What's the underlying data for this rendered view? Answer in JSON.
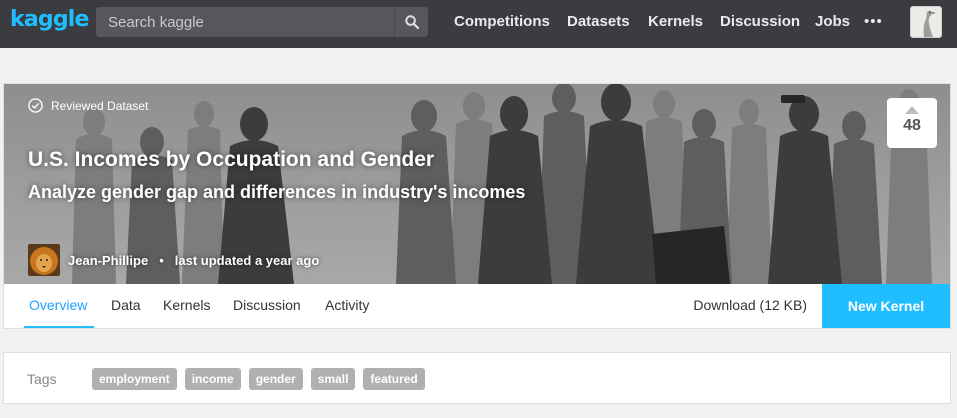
{
  "nav": {
    "logo": "kaggle",
    "search_placeholder": "Search kaggle",
    "items": [
      {
        "label": "Competitions"
      },
      {
        "label": "Datasets"
      },
      {
        "label": "Kernels"
      },
      {
        "label": "Discussion"
      },
      {
        "label": "Jobs"
      }
    ],
    "more": "•••",
    "icons": {
      "search": "search-icon",
      "more": "more-icon",
      "avatar": "user-avatar"
    }
  },
  "dataset": {
    "badge": "Reviewed Dataset",
    "title": "U.S. Incomes by Occupation and Gender",
    "subtitle": "Analyze gender gap and differences in industry's incomes",
    "owner": "Jean-Phillipe",
    "separator": "•",
    "updated": "last updated a year ago",
    "votes": "48"
  },
  "tabs": {
    "items": [
      {
        "label": "Overview",
        "active": true
      },
      {
        "label": "Data",
        "active": false
      },
      {
        "label": "Kernels",
        "active": false
      },
      {
        "label": "Discussion",
        "active": false
      },
      {
        "label": "Activity",
        "active": false
      }
    ],
    "download": "Download (12 KB)",
    "new_kernel": "New Kernel"
  },
  "tags": {
    "label": "Tags",
    "items": [
      "employment",
      "income",
      "gender",
      "small",
      "featured"
    ]
  },
  "colors": {
    "brand": "#20beff",
    "nav_bg": "#3a3c40",
    "tag_bg": "#b0b0b0"
  }
}
